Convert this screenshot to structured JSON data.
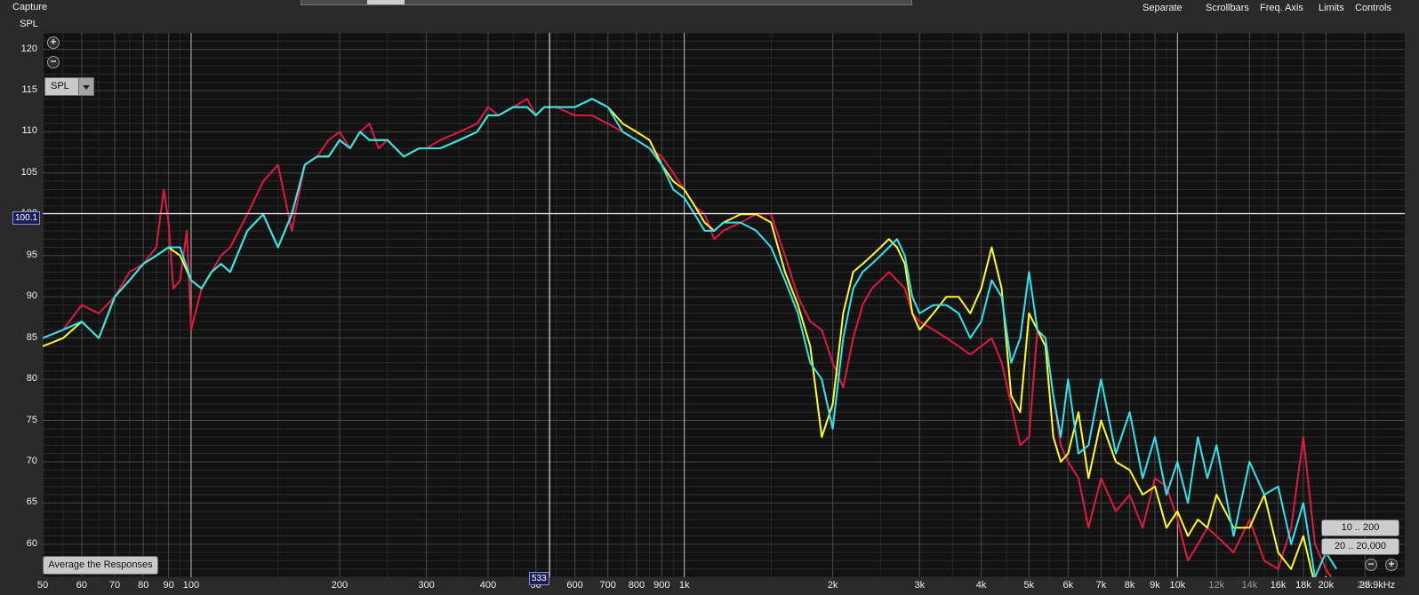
{
  "header": {
    "capture": "Capture",
    "menu": [
      "Separate",
      "Scrollbars",
      "Freq. Axis",
      "Limits",
      "Controls"
    ]
  },
  "yaxis": {
    "title": "SPL"
  },
  "controls": {
    "spl_select": "SPL",
    "average_button": "Average the Responses",
    "range_low": "10 .. 200",
    "range_high": "20 .. 20,000",
    "x_end_label": "28.9kHz"
  },
  "cursor": {
    "spl": "100.1",
    "freq": "533"
  },
  "colors": {
    "background": "#121212",
    "series_red": "#e21844",
    "series_yellow": "#ffff22",
    "series_cyan": "#2ee6f0",
    "cursor": "#ffffff",
    "readout_bg": "#1c1f55"
  },
  "chart_data": {
    "type": "line",
    "xscale": "log",
    "xlim": [
      50,
      28900
    ],
    "ylim": [
      56,
      122
    ],
    "grid": true,
    "yticks": [
      60,
      65,
      70,
      75,
      80,
      85,
      90,
      95,
      100,
      105,
      110,
      115,
      120
    ],
    "xticks": [
      {
        "v": 50,
        "label": "50"
      },
      {
        "v": 60,
        "label": "60"
      },
      {
        "v": 70,
        "label": "70"
      },
      {
        "v": 80,
        "label": "80"
      },
      {
        "v": 90,
        "label": "90"
      },
      {
        "v": 100,
        "label": "100"
      },
      {
        "v": 200,
        "label": "200"
      },
      {
        "v": 300,
        "label": "300"
      },
      {
        "v": 400,
        "label": "400"
      },
      {
        "v": 500,
        "label": "50"
      },
      {
        "v": 600,
        "label": "600"
      },
      {
        "v": 700,
        "label": "700"
      },
      {
        "v": 800,
        "label": "800"
      },
      {
        "v": 900,
        "label": "900"
      },
      {
        "v": 1000,
        "label": "1k"
      },
      {
        "v": 2000,
        "label": "2k"
      },
      {
        "v": 3000,
        "label": "3k"
      },
      {
        "v": 4000,
        "label": "4k"
      },
      {
        "v": 5000,
        "label": "5k"
      },
      {
        "v": 6000,
        "label": "6k"
      },
      {
        "v": 7000,
        "label": "7k"
      },
      {
        "v": 8000,
        "label": "8k"
      },
      {
        "v": 9000,
        "label": "9k"
      },
      {
        "v": 10000,
        "label": "10k"
      },
      {
        "v": 12000,
        "label": "12k"
      },
      {
        "v": 14000,
        "label": "14k"
      },
      {
        "v": 16000,
        "label": "16k"
      },
      {
        "v": 18000,
        "label": "18k"
      },
      {
        "v": 20000,
        "label": "20k"
      },
      {
        "v": 24000,
        "label": "24k"
      }
    ],
    "cursor": {
      "x": 533,
      "y": 100.1
    },
    "series": [
      {
        "color": "#e21844",
        "x": [
          50,
          55,
          60,
          65,
          70,
          75,
          80,
          85,
          88,
          90,
          92,
          95,
          98,
          100,
          102,
          105,
          110,
          115,
          120,
          130,
          140,
          150,
          160,
          170,
          180,
          190,
          200,
          210,
          220,
          230,
          240,
          250,
          270,
          290,
          300,
          320,
          350,
          380,
          400,
          420,
          450,
          480,
          500,
          520,
          550,
          600,
          650,
          700,
          750,
          800,
          850,
          900,
          950,
          1000,
          1050,
          1100,
          1150,
          1200,
          1300,
          1400,
          1500,
          1600,
          1700,
          1800,
          1900,
          2000,
          2100,
          2200,
          2300,
          2400,
          2500,
          2600,
          2700,
          2800,
          2900,
          3000,
          3200,
          3400,
          3600,
          3800,
          4000,
          4200,
          4400,
          4600,
          4800,
          5000,
          5200,
          5400,
          5600,
          5800,
          6000,
          6300,
          6600,
          7000,
          7500,
          8000,
          8500,
          9000,
          9500,
          10000,
          10500,
          11000,
          11500,
          12000,
          13000,
          14000,
          15000,
          16000,
          17000,
          18000,
          19000,
          20000,
          21000
        ],
        "y": [
          85,
          86,
          89,
          88,
          90,
          93,
          94,
          96,
          103,
          99,
          91,
          92,
          98,
          86,
          88,
          91,
          93,
          95,
          96,
          100,
          104,
          106,
          98,
          106,
          107,
          109,
          110,
          108,
          110,
          111,
          108,
          109,
          107,
          108,
          108,
          109,
          110,
          111,
          113,
          112,
          113,
          114,
          112,
          113,
          113,
          112,
          112,
          111,
          110,
          109,
          108,
          107,
          105,
          103,
          101,
          100,
          97,
          98,
          99,
          100,
          100,
          95,
          90,
          87,
          86,
          82,
          79,
          85,
          89,
          91,
          92,
          93,
          92,
          91,
          88,
          87,
          86,
          85,
          84,
          83,
          84,
          85,
          82,
          77,
          72,
          73,
          86,
          85,
          78,
          72,
          70,
          68,
          62,
          68,
          64,
          66,
          62,
          68,
          67,
          63,
          58,
          60,
          62,
          61,
          59,
          63,
          58,
          57,
          62,
          73,
          60,
          57,
          55
        ]
      },
      {
        "color": "#ffff22",
        "x": [
          50,
          55,
          60,
          65,
          70,
          75,
          80,
          85,
          90,
          95,
          100,
          105,
          110,
          115,
          120,
          130,
          140,
          150,
          160,
          170,
          180,
          190,
          200,
          210,
          220,
          230,
          240,
          250,
          270,
          290,
          300,
          320,
          350,
          380,
          400,
          420,
          450,
          480,
          500,
          520,
          550,
          600,
          650,
          700,
          750,
          800,
          850,
          900,
          950,
          1000,
          1050,
          1100,
          1150,
          1200,
          1300,
          1400,
          1500,
          1600,
          1700,
          1800,
          1900,
          2000,
          2100,
          2200,
          2300,
          2400,
          2500,
          2600,
          2700,
          2800,
          2900,
          3000,
          3200,
          3400,
          3600,
          3800,
          4000,
          4200,
          4400,
          4600,
          4800,
          5000,
          5200,
          5400,
          5600,
          5800,
          6000,
          6300,
          6600,
          7000,
          7500,
          8000,
          8500,
          9000,
          9500,
          10000,
          10500,
          11000,
          11500,
          12000,
          13000,
          14000,
          15000,
          16000,
          17000,
          18000,
          19000,
          20000,
          21000
        ],
        "y": [
          84,
          85,
          87,
          85,
          90,
          92,
          94,
          95,
          96,
          95,
          92,
          91,
          93,
          94,
          93,
          98,
          100,
          96,
          100,
          106,
          107,
          107,
          109,
          108,
          110,
          109,
          109,
          109,
          107,
          108,
          108,
          108,
          109,
          110,
          112,
          112,
          113,
          113,
          112,
          113,
          113,
          113,
          114,
          113,
          111,
          110,
          109,
          106,
          104,
          103,
          101,
          99,
          98,
          99,
          100,
          100,
          99,
          93,
          89,
          84,
          73,
          77,
          88,
          93,
          94,
          95,
          96,
          97,
          96,
          94,
          88,
          86,
          88,
          90,
          90,
          88,
          91,
          96,
          91,
          78,
          76,
          88,
          86,
          84,
          73,
          70,
          71,
          76,
          68,
          75,
          70,
          69,
          66,
          67,
          62,
          64,
          61,
          63,
          62,
          66,
          62,
          62,
          66,
          59,
          57,
          61,
          55,
          56,
          54
        ]
      },
      {
        "color": "#2ee6f0",
        "x": [
          50,
          55,
          60,
          65,
          70,
          75,
          80,
          85,
          90,
          95,
          100,
          105,
          110,
          115,
          120,
          130,
          140,
          150,
          160,
          170,
          180,
          190,
          200,
          210,
          220,
          230,
          240,
          250,
          270,
          290,
          300,
          320,
          350,
          380,
          400,
          420,
          450,
          480,
          500,
          520,
          550,
          600,
          650,
          700,
          750,
          800,
          850,
          900,
          950,
          1000,
          1050,
          1100,
          1150,
          1200,
          1300,
          1400,
          1500,
          1600,
          1700,
          1800,
          1900,
          2000,
          2100,
          2200,
          2300,
          2400,
          2500,
          2600,
          2700,
          2800,
          2900,
          3000,
          3200,
          3400,
          3600,
          3800,
          4000,
          4200,
          4400,
          4600,
          4800,
          5000,
          5200,
          5400,
          5600,
          5800,
          6000,
          6300,
          6600,
          7000,
          7500,
          8000,
          8500,
          9000,
          9500,
          10000,
          10500,
          11000,
          11500,
          12000,
          13000,
          14000,
          15000,
          16000,
          17000,
          18000,
          19000,
          20000,
          21000
        ],
        "y": [
          85,
          86,
          87,
          85,
          90,
          92,
          94,
          95,
          96,
          96,
          92,
          91,
          93,
          94,
          93,
          98,
          100,
          96,
          100,
          106,
          107,
          107,
          109,
          108,
          110,
          109,
          109,
          109,
          107,
          108,
          108,
          108,
          109,
          110,
          112,
          112,
          113,
          113,
          112,
          113,
          113,
          113,
          114,
          113,
          110,
          109,
          108,
          106,
          103,
          102,
          100,
          98,
          98,
          99,
          99,
          98,
          96,
          92,
          88,
          82,
          80,
          74,
          85,
          91,
          93,
          94,
          95,
          96,
          97,
          95,
          90,
          88,
          89,
          89,
          88,
          85,
          87,
          92,
          90,
          82,
          85,
          93,
          86,
          85,
          78,
          73,
          80,
          71,
          72,
          80,
          71,
          76,
          68,
          73,
          66,
          70,
          65,
          73,
          68,
          72,
          61,
          70,
          66,
          67,
          60,
          65,
          56,
          59,
          57
        ]
      }
    ]
  }
}
